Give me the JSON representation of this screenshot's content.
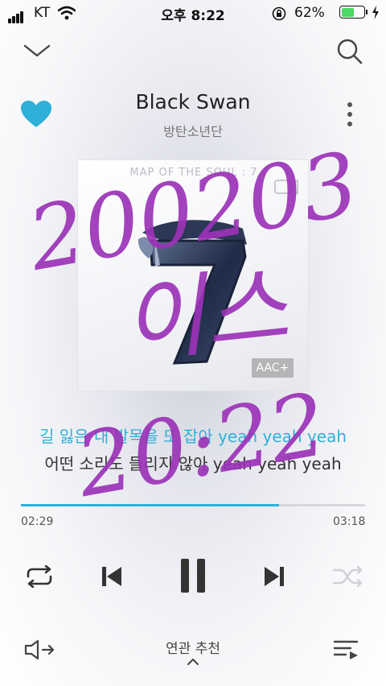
{
  "status": {
    "carrier": "KT",
    "time": "오후 8:22",
    "battery": "62%",
    "battery_level": 0.62
  },
  "header": {
    "collapse_icon": "chevron-down-icon",
    "search_icon": "search-icon",
    "favorite_icon": "heart-icon",
    "more_icon": "more-vertical-icon"
  },
  "track": {
    "title": "Black Swan",
    "artist": "방탄소년단"
  },
  "cover": {
    "album_text": "MAP OF THE SOUL : 7",
    "quality_badge": "AAC+"
  },
  "lyrics": {
    "current": "길 잃은 내 발목을 또 잡아 yeah yeah yeah",
    "next": "어떤 소리도 들리지 않아 yeah yeah yeah"
  },
  "progress": {
    "elapsed": "02:29",
    "total": "03:18",
    "fraction": 0.75
  },
  "bottom": {
    "related_label": "연관 추천"
  },
  "overlay": {
    "line1": "200203",
    "line2": "이스",
    "line3": "20:22"
  },
  "colors": {
    "accent": "#2fb0d8",
    "handwriting": "#9c33b8"
  }
}
